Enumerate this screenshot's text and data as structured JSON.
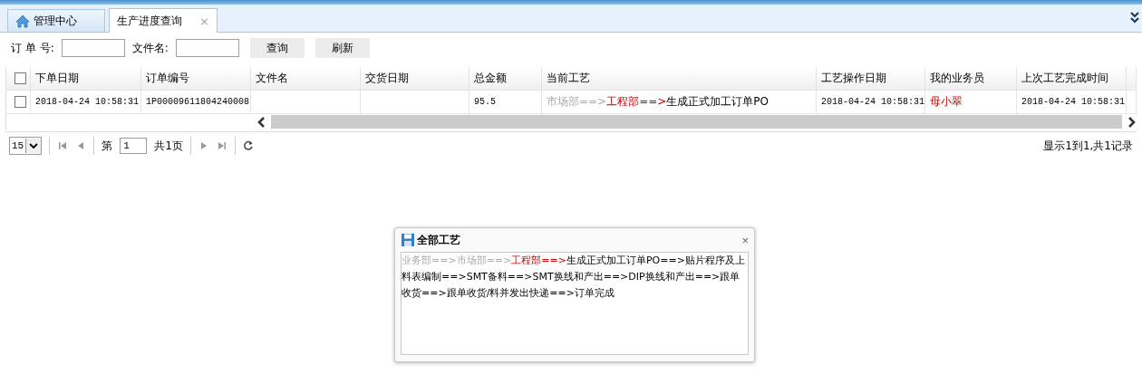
{
  "tabs": [
    {
      "label": "管理中心",
      "kind": "home",
      "selected": false
    },
    {
      "label": "生产进度查询",
      "kind": "closable",
      "close": "×",
      "selected": true
    }
  ],
  "search": {
    "fields": [
      {
        "label": "订 单 号:"
      },
      {
        "label": "文件名:"
      }
    ],
    "buttons": [
      "查询",
      "刷新"
    ]
  },
  "table": {
    "all_checked": false,
    "columns": [
      "下单日期",
      "订单编号",
      "文件名",
      "交货日期",
      "总金额",
      "当前工艺",
      "工艺操作日期",
      "我的业务员",
      "上次工艺完成时间"
    ],
    "rows": [
      {
        "checked": false,
        "order_date": "2018-04-24 10:58:31",
        "order_no": "1P00009611804240008",
        "amount": "95.5",
        "process": [
          {
            "text": "市场部==>",
            "color": "#aaaaaa"
          },
          {
            "text": "工程部==>",
            "color": "#cc0000"
          },
          {
            "text": "生成正式加工订单PO",
            "color": "#000000"
          }
        ],
        "process_date": "2018-04-24 10:58:31",
        "salesperson": "母小翠",
        "last_done": "2018-04-24 10:58:31"
      }
    ]
  },
  "pager": {
    "page_size": "15",
    "page_label": "第",
    "page": "1",
    "total_pages": "共1页",
    "summary": "显示1到1,共1记录"
  },
  "dialog": {
    "title": "全部工艺",
    "close": "×",
    "steps": [
      {
        "text": "业务部==>",
        "color": "#aaaaaa"
      },
      {
        "text": "市场部==>",
        "color": "#aaaaaa"
      },
      {
        "text": "工程部==>",
        "color": "#cc0000"
      },
      {
        "text": "生成正式加工订单PO==>贴片程序及上料表编制==>SMT备料==>SMT换线和产出==>DIP换线和产出==>跟单收货==>跟单收货/料并发出快递==>订单完成",
        "color": "#000000"
      }
    ]
  }
}
